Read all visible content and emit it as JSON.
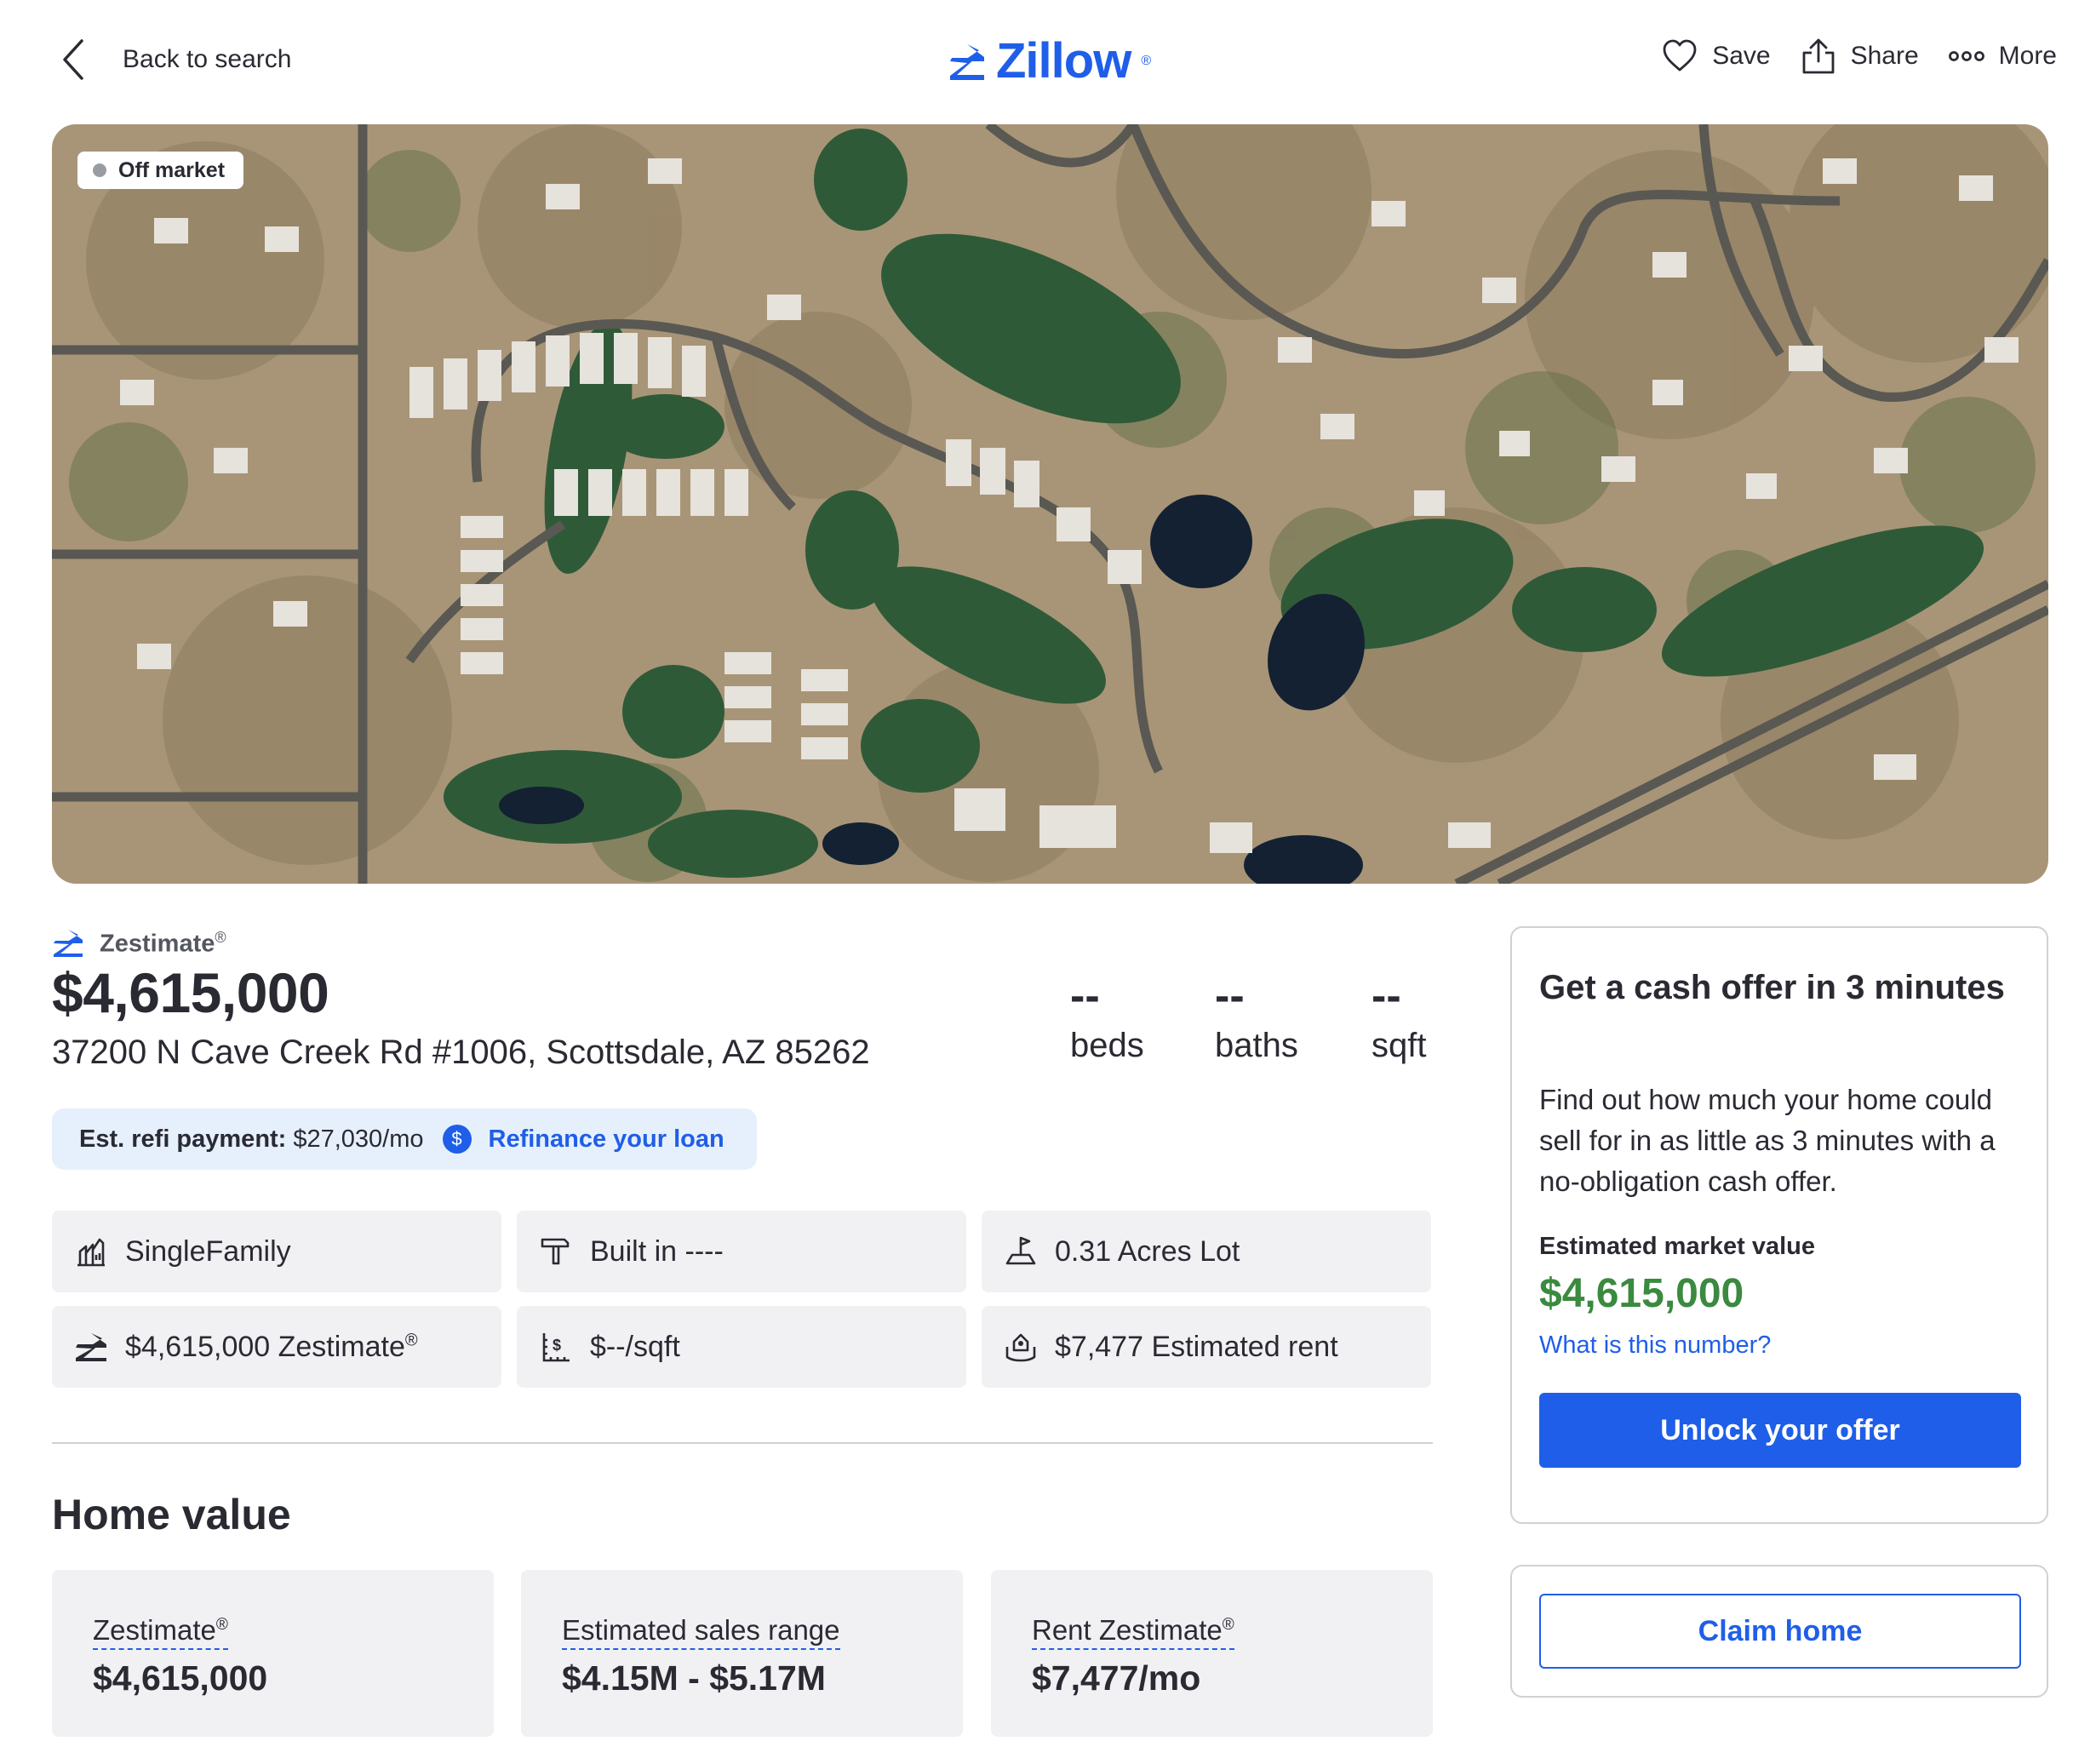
{
  "header": {
    "back_label": "Back to search",
    "logo_text": "Zillow",
    "logo_mark": "®",
    "actions": {
      "save": "Save",
      "share": "Share",
      "more": "More"
    }
  },
  "hero": {
    "status_badge": "Off market"
  },
  "summary": {
    "zestimate_label": "Zestimate",
    "reg_mark": "®",
    "price": "$4,615,000",
    "address": "37200 N Cave Creek Rd #1006, Scottsdale, AZ 85262",
    "stats": [
      {
        "value": "--",
        "label": "beds"
      },
      {
        "value": "--",
        "label": "baths"
      },
      {
        "value": "--",
        "label": "sqft"
      }
    ]
  },
  "refi": {
    "label": "Est. refi payment:",
    "amount": "$27,030/mo",
    "dollar_glyph": "$",
    "link": "Refinance your loan"
  },
  "facts": [
    {
      "icon": "house-type-icon",
      "text": "SingleFamily"
    },
    {
      "icon": "hammer-icon",
      "text": "Built in ----"
    },
    {
      "icon": "lot-size-icon",
      "text": "0.31 Acres Lot"
    },
    {
      "icon": "zestimate-icon",
      "text": "$4,615,000 Zestimate",
      "sup": "®"
    },
    {
      "icon": "price-per-sqft-icon",
      "text": "$--/sqft"
    },
    {
      "icon": "rent-icon",
      "text": "$7,477 Estimated rent"
    }
  ],
  "home_value": {
    "title": "Home value",
    "cards": [
      {
        "title": "Zestimate",
        "sup": "®",
        "value": "$4,615,000"
      },
      {
        "title": "Estimated sales range",
        "sup": "",
        "value": "$4.15M - $5.17M"
      },
      {
        "title": "Rent Zestimate",
        "sup": "®",
        "value": "$7,477/mo"
      }
    ]
  },
  "cash_offer": {
    "title": "Get a cash offer in 3 minutes",
    "description": "Find out how much your home could sell for in as little as 3 minutes with a no-obligation cash offer.",
    "market_value_label": "Estimated market value",
    "market_value": "$4,615,000",
    "what_link": "What is this number?",
    "button": "Unlock your offer"
  },
  "claim": {
    "button": "Claim home"
  },
  "colors": {
    "brand_blue": "#1f5ee8",
    "value_green": "#3a8a3f",
    "tile_bg": "#f1f1f4",
    "refi_bg": "#e6f0fc"
  }
}
